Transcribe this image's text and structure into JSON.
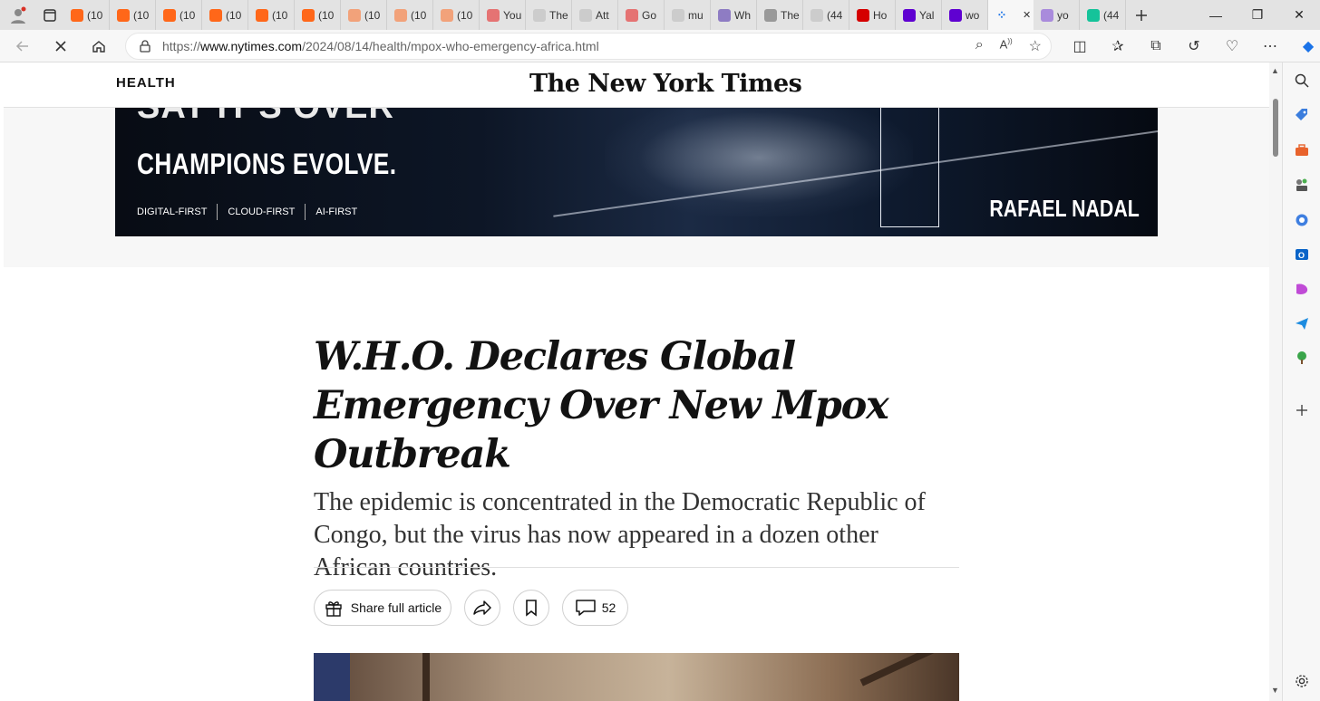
{
  "browser": {
    "tabs": [
      {
        "label": "(10",
        "icon": "substack-icon",
        "color": "#ff6719"
      },
      {
        "label": "(10",
        "icon": "substack-icon",
        "color": "#ff6719"
      },
      {
        "label": "(10",
        "icon": "substack-icon",
        "color": "#ff6719"
      },
      {
        "label": "(10",
        "icon": "substack-icon",
        "color": "#ff6719"
      },
      {
        "label": "(10",
        "icon": "substack-icon",
        "color": "#ff6719"
      },
      {
        "label": "(10",
        "icon": "substack-icon",
        "color": "#ff6719"
      },
      {
        "label": "(10",
        "icon": "substack-icon",
        "color": "#f2a27a"
      },
      {
        "label": "(10",
        "icon": "substack-icon",
        "color": "#f2a27a"
      },
      {
        "label": "(10",
        "icon": "substack-icon",
        "color": "#f2a27a"
      },
      {
        "label": "You",
        "icon": "youtube-icon",
        "color": "#e57373"
      },
      {
        "label": "The",
        "icon": "page-icon",
        "color": "#cccccc"
      },
      {
        "label": "Att",
        "icon": "page-icon",
        "color": "#cccccc"
      },
      {
        "label": "Go",
        "icon": "youtube-icon",
        "color": "#e57373"
      },
      {
        "label": "mu",
        "icon": "page-icon",
        "color": "#cccccc"
      },
      {
        "label": "Wh",
        "icon": "shield-icon",
        "color": "#8e7cc3"
      },
      {
        "label": "The",
        "icon": "dots-icon",
        "color": "#999999"
      },
      {
        "label": "(44",
        "icon": "page-icon",
        "color": "#cccccc"
      },
      {
        "label": "Ho",
        "icon": "bookmark-red-icon",
        "color": "#d50000"
      },
      {
        "label": "Yal",
        "icon": "yahoo-icon",
        "color": "#5f01d1"
      },
      {
        "label": "wo",
        "icon": "yahoo-icon",
        "color": "#5f01d1"
      },
      {
        "label": "",
        "icon": "loading-icon",
        "color": "#1a73e8",
        "active": true
      },
      {
        "label": "yo",
        "icon": "yahoo-icon",
        "color": "#a98bdc"
      },
      {
        "label": "(44",
        "icon": "grammarly-icon",
        "color": "#15c39a"
      }
    ],
    "url_prefix": "https://",
    "url_host": "www.nytimes.com",
    "url_path": "/2024/08/14/health/mpox-who-emergency-africa.html"
  },
  "nyt": {
    "section": "HEALTH",
    "masthead": "The New York Times"
  },
  "ad": {
    "top_text": "SAY IT'S OVER",
    "headline": "CHAMPIONS EVOLVE.",
    "tags": [
      "DIGITAL-FIRST",
      "CLOUD-FIRST",
      "AI-FIRST"
    ],
    "brand": "RAFAEL NADAL"
  },
  "article": {
    "headline": "W.H.O. Declares Global Emergency Over New Mpox Outbreak",
    "summary": "The epidemic is concentrated in the Democratic Republic of Congo, but the virus has now appeared in a dozen other African countries.",
    "share_label": "Share full article",
    "comment_count": "52"
  }
}
